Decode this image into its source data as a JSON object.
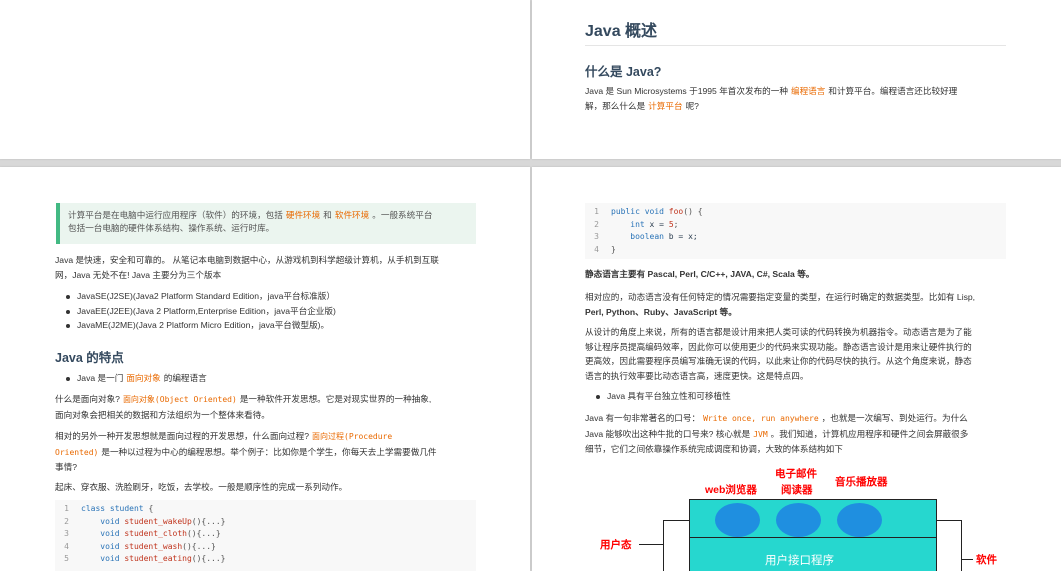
{
  "top_right": {
    "title": "Java 概述",
    "section_title": "什么是 Java?",
    "intro_pre": "Java 是 Sun Microsystems 于1995 年首次发布的一种",
    "intro_hl1": "编程语言",
    "intro_mid": "和计算平台。编程语言还比较好理",
    "intro_line2_pre": "解，那么什么是",
    "intro_hl2": "计算平台",
    "intro_line2_post": "呢?"
  },
  "bottom_left": {
    "tip_line1_pre": "计算平台是在电脑中运行应用程序（软件）的环境，包括",
    "tip_hl1": "硬件环境",
    "tip_and": "和",
    "tip_hl2": "软件环境",
    "tip_line1_post": "。一般系统平台",
    "tip_line2": "包括一台电脑的硬件体系结构、操作系统、运行时库。",
    "para1_line1": "Java 是快速，安全和可靠的。 从笔记本电脑到数据中心，从游戏机到科学超级计算机，从手机到互联",
    "para1_line2": "网，Java 无处不在! Java 主要分为三个版本",
    "editions": [
      "JavaSE(J2SE)(Java2 Platform Standard Edition，java平台标准版）",
      "JavaEE(J2EE)(Java 2 Platform,Enterprise Edition，java平台企业版)",
      "JavaME(J2ME)(Java 2 Platform Micro Edition，java平台微型版)。"
    ],
    "features_title": "Java 的特点",
    "feature1_pre": "Java 是一门",
    "feature1_hl": "面向对象",
    "feature1_post": "的编程语言",
    "oo_line1_pre": "什么是面向对象?",
    "oo_code": "面向对象(Object Oriented)",
    "oo_line1_post": "是一种软件开发思想。它是对现实世界的一种抽象,",
    "oo_line2": "面向对象会把相关的数据和方法组织为一个整体来看待。",
    "po_line1_pre": "相对的另外一种开发思想就是面向过程的开发思想，什么面向过程?",
    "po_code1": "面向过程(Procedure",
    "po_code2": "Oriented)",
    "po_line2_post": "是一种以过程为中心的编程思想。举个例子：比如你是个学生，你每天去上学需要做几件",
    "po_line3": "事情?",
    "steps": "起床、穿衣服、洗脸刷牙，吃饭，去学校。一般是顺序性的完成一系列动作。",
    "code": [
      {
        "ln": "1",
        "parts": [
          {
            "c": "kw",
            "t": "class "
          },
          {
            "c": "ty",
            "t": "student"
          },
          {
            "c": "cc",
            "t": " {"
          }
        ]
      },
      {
        "ln": "2",
        "parts": [
          {
            "c": "ct",
            "t": "    "
          },
          {
            "c": "kw",
            "t": "void"
          },
          {
            "c": "fn",
            "t": " student_wakeUp"
          },
          {
            "c": "cc",
            "t": "(){...}"
          }
        ]
      },
      {
        "ln": "3",
        "parts": [
          {
            "c": "ct",
            "t": "    "
          },
          {
            "c": "kw",
            "t": "void"
          },
          {
            "c": "fn",
            "t": " student_cloth"
          },
          {
            "c": "cc",
            "t": "(){...}"
          }
        ]
      },
      {
        "ln": "4",
        "parts": [
          {
            "c": "ct",
            "t": "    "
          },
          {
            "c": "kw",
            "t": "void"
          },
          {
            "c": "fn",
            "t": " student_wash"
          },
          {
            "c": "cc",
            "t": "(){...}"
          }
        ]
      },
      {
        "ln": "5",
        "parts": [
          {
            "c": "ct",
            "t": "    "
          },
          {
            "c": "kw",
            "t": "void"
          },
          {
            "c": "fn",
            "t": " student_eating"
          },
          {
            "c": "cc",
            "t": "(){...}"
          }
        ]
      }
    ]
  },
  "bottom_right": {
    "code": [
      {
        "ln": "1",
        "parts": [
          {
            "c": "kw",
            "t": "public void "
          },
          {
            "c": "fn",
            "t": "foo"
          },
          {
            "c": "cc",
            "t": "() {"
          }
        ]
      },
      {
        "ln": "2",
        "parts": [
          {
            "c": "ct",
            "t": "    "
          },
          {
            "c": "kw",
            "t": "int"
          },
          {
            "c": "ct",
            "t": " x = "
          },
          {
            "c": "num",
            "t": "5"
          },
          {
            "c": "cc",
            "t": ";"
          }
        ]
      },
      {
        "ln": "3",
        "parts": [
          {
            "c": "ct",
            "t": "    "
          },
          {
            "c": "kw",
            "t": "boolean"
          },
          {
            "c": "ct",
            "t": " b = x;"
          }
        ]
      },
      {
        "ln": "4",
        "parts": [
          {
            "c": "cc",
            "t": "}"
          }
        ]
      }
    ],
    "static_langs": "静态语言主要有 Pascal, Perl, C/C++, JAVA, C#, Scala 等。",
    "dyn_line1": "相对应的，动态语言没有任何特定的情况需要指定变量的类型，在运行时确定的数据类型。比如有 Lisp,",
    "dyn_line2": "Perl, Python、Ruby、JavaScript 等。",
    "design_line1": "从设计的角度上来说，所有的语言都是设计用来把人类可读的代码转换为机器指令。动态语言是为了能",
    "design_line2": "够让程序员提高编码效率，因此你可以使用更少的代码来实现功能。静态语言设计是用来让硬件执行的",
    "design_line3": "更高效，因此需要程序员编写准确无误的代码，以此来让你的代码尽快的执行。从这个角度来说，静态",
    "design_line4": "语言的执行效率要比动态语言高，速度更快。这是特点四。",
    "bullet_platform": "Java 具有平台独立性和可移植性",
    "slogan_pre": "Java 有一句非常著名的口号：",
    "slogan_code": "Write once, run anywhere",
    "slogan_post": "，也就是一次编写、到处运行。为什么",
    "jvm_pre": "Java 能够吹出这种牛批的口号来? 核心就是",
    "jvm_code": "JVM",
    "jvm_post": "。我们知道，计算机应用程序和硬件之间会屏蔽很多",
    "jvm_line3": "细节，它们之间依靠操作系统完成调度和协调，大致的体系结构如下",
    "diagram": {
      "label_browser": "web浏览器",
      "label_email1": "电子邮件",
      "label_email2": "阅读器",
      "label_music": "音乐播放器",
      "label_user_mode": "用户态",
      "label_software": "软件",
      "ui_program": "用户接口程序",
      "box_color": "#26d7cf",
      "ellipse_color": "#1f8fe0",
      "label_color": "#ff0000"
    }
  },
  "colors": {
    "heading": "#34495e",
    "accent_orange": "#e96900",
    "tip_border": "#42b983",
    "tip_bg": "#ebf5ef"
  }
}
